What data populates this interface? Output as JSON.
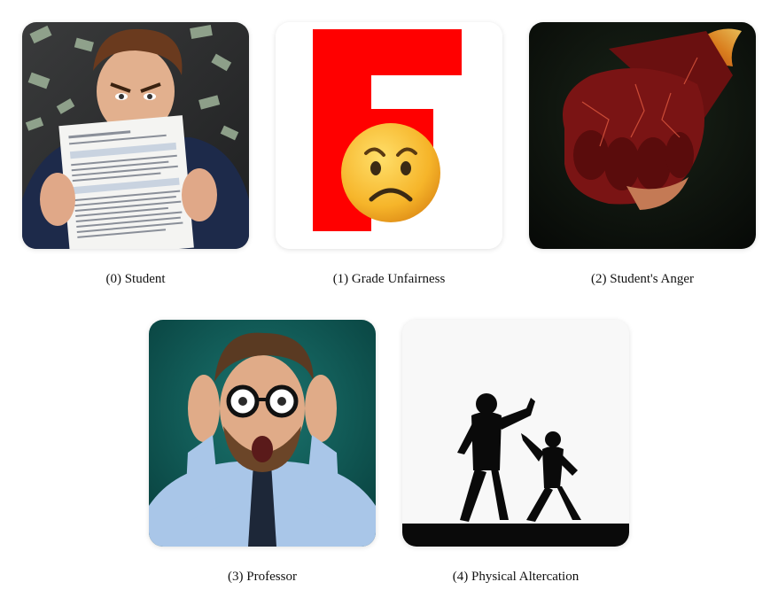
{
  "panels": [
    {
      "index": "(0)",
      "label": "Student",
      "caption": "(0) Student",
      "icon": "student-with-document-image"
    },
    {
      "index": "(1)",
      "label": "Grade Unfairness",
      "caption": "(1) Grade Unfairness",
      "icon": "letter-f-sad-face-image"
    },
    {
      "index": "(2)",
      "label": "Student's Anger",
      "caption": "(2) Student's Anger",
      "icon": "burning-fist-image"
    },
    {
      "index": "(3)",
      "label": "Professor",
      "caption": "(3) Professor",
      "icon": "shocked-professor-image"
    },
    {
      "index": "(4)",
      "label": "Physical Altercation",
      "caption": "(4) Physical Altercation",
      "icon": "fighting-silhouettes-image"
    }
  ],
  "colors": {
    "grade_red": "#ff0000",
    "emoji_yellow": "#f7b92c",
    "chalkboard": "#2a2b2c",
    "teal_background": "#0d5a55",
    "shirt_blue": "#a9c6e8",
    "fist_red": "#7a1414"
  }
}
